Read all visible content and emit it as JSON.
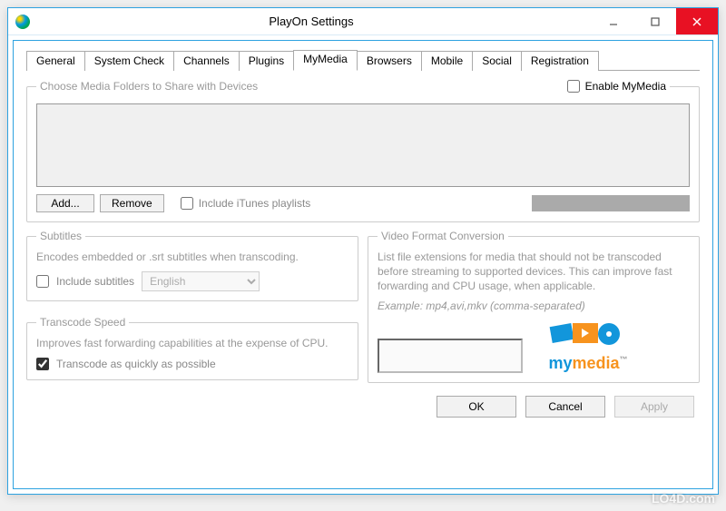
{
  "window": {
    "title": "PlayOn Settings"
  },
  "tabs": [
    {
      "label": "General"
    },
    {
      "label": "System Check"
    },
    {
      "label": "Channels"
    },
    {
      "label": "Plugins"
    },
    {
      "label": "MyMedia",
      "active": true
    },
    {
      "label": "Browsers"
    },
    {
      "label": "Mobile"
    },
    {
      "label": "Social"
    },
    {
      "label": "Registration"
    }
  ],
  "mediaFolders": {
    "legend": "Choose Media Folders to Share with Devices",
    "enable_label": "Enable MyMedia",
    "enable_checked": false,
    "add_label": "Add...",
    "remove_label": "Remove",
    "itunes_label": "Include iTunes playlists",
    "itunes_checked": false
  },
  "subtitles": {
    "legend": "Subtitles",
    "desc": "Encodes embedded or .srt subtitles when transcoding.",
    "include_label": "Include subtitles",
    "include_checked": false,
    "language": "English"
  },
  "transcode": {
    "legend": "Transcode Speed",
    "desc": "Improves fast forwarding capabilities at the expense of CPU.",
    "fast_label": "Transcode as quickly as possible",
    "fast_checked": true
  },
  "videoFormat": {
    "legend": "Video Format Conversion",
    "desc": "List file extensions for media that should not be transcoded before streaming to supported devices. This can improve fast forwarding and CPU usage, when applicable.",
    "example": "Example: mp4,avi,mkv (comma-separated)",
    "logo_text_a": "my",
    "logo_text_b": "media"
  },
  "buttons": {
    "ok": "OK",
    "cancel": "Cancel",
    "apply": "Apply"
  },
  "watermark": "LO4D.com"
}
